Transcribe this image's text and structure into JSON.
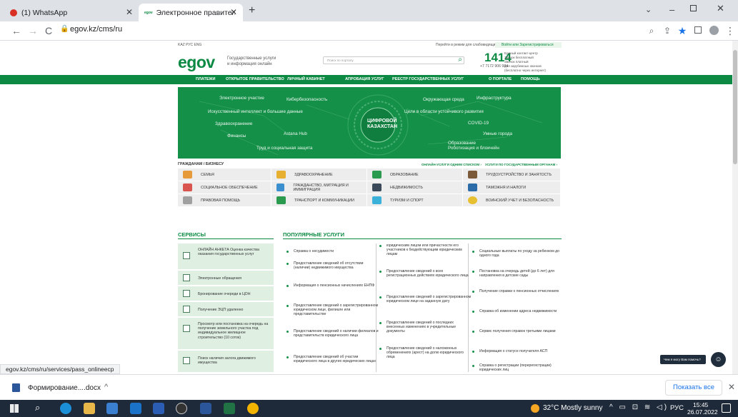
{
  "browser": {
    "tab1": "(1) WhatsApp",
    "tab2": "Электронное правительство Ре",
    "url": "egov.kz/cms/ru",
    "status_url": "egov.kz/cms/ru/services/pass_onlineecp"
  },
  "top": {
    "langs": "KAZ  РУС  ENG",
    "vision": "Перейти в режим для слабовидящих",
    "login": "Войти или Зарегистрироваться",
    "logo": "egov",
    "tagline1": "Государственные услуги",
    "tagline2": "и информация онлайн",
    "search_placeholder": "Поиск по порталу",
    "phone": "1414",
    "phone_sub": "+7 7172 906 984",
    "phone_l1": "Единый контакт-центр",
    "phone_l2": "Звонок бесплатный",
    "phone_l3": "Звонок платный",
    "phone_l4": "для зарубежных звонков",
    "phone_l5": "(бесплатно через интернет)"
  },
  "nav": [
    "ПЛАТЕЖИ",
    "ОТКРЫТОЕ ПРАВИТЕЛЬСТВО",
    "ЛИЧНЫЙ КАБИНЕТ",
    "АПРОБАЦИЯ УСЛУГ",
    "РЕЕСТР ГОСУДАРСТВЕННЫХ УСЛУГ",
    "О ПОРТАЛЕ",
    "ПОМОЩЬ"
  ],
  "banner": {
    "center1": "ЦИФРОВОЙ",
    "center2": "КАЗАХСТАН",
    "items": [
      "Электронное участие",
      "Кибербезопасность",
      "Окружающая среда",
      "Инфраструктура",
      "Искусственный интеллект и большие данные",
      "Цели в области устойчивого развития",
      "Здравоохранение",
      "COVID-19",
      "Финансы",
      "Astana Hub",
      "Умные города",
      "Образование",
      "Труд и социальная защита",
      "Роботизация и блокчейн"
    ]
  },
  "audience": {
    "label": "ГРАЖДАНАМ / БИЗНЕСУ",
    "online": "ОНЛАЙН-УСЛУГИ ОДНИМ СПИСКОМ ›",
    "by_org": "УСЛУГИ ПО ГОСУДАРСТВЕННЫМ ОРГАНАМ ›"
  },
  "categories": [
    "СЕМЬЯ",
    "ЗДРАВООХРАНЕНИЕ",
    "ОБРАЗОВАНИЕ",
    "ТРУДОУСТРОЙСТВО И ЗАНЯТОСТЬ",
    "СОЦИАЛЬНОЕ ОБЕСПЕЧЕНИЕ",
    "ГРАЖДАНСТВО, МИГРАЦИЯ И ИММИГРАЦИЯ",
    "НЕДВИЖИМОСТЬ",
    "ТАМОЖНЯ И НАЛОГИ",
    "ПРАВОВАЯ ПОМОЩЬ",
    "ТРАНСПОРТ И КОММУНИКАЦИИ",
    "ТУРИЗМ И СПОРТ",
    "ВОИНСКИЙ УЧЕТ И БЕЗОПАСНОСТЬ"
  ],
  "services_title": "СЕРВИСЫ",
  "services": [
    "ОНЛАЙН АНКЕТА Оценка качества оказания государственных услуг",
    "Электронные обращения",
    "Бронирование очереди в ЦОН",
    "Получение ЭЦП удаленно",
    "Просмотр или постановка на очередь на получение земельного участка под индивидуальное жилищное строительство (10 соток)",
    "Поиск наличия залога движимого имущества"
  ],
  "popular_title": "ПОПУЛЯРНЫЕ УСЛУГИ",
  "popular": [
    "Справка о несудимости",
    "Предоставление сведений об отсутствии (наличии) недвижимого имущества",
    "Информация о пенсионных начислениях ЕНПФ",
    "Предоставление сведений о зарегистрированном юридическом лице, филиале или представительстве",
    "Предоставление сведений о наличии филиалов и представительств юридического лица",
    "Предоставление сведений об участии юридического лица в других юридических лицах",
    "юридическим лицом или причастности его участников к бездействующим юридическим лицам",
    "Предоставление сведений о всех регистрационных действиях юридического лица",
    "Предоставление сведений о зарегистрированном юридическом лице на заданную дату",
    "Предоставление сведений о последних внесенных изменениях в учредительные документы",
    "Предоставление сведений о наложенных обременениях (арест) на долю юридического лица",
    "Социальные выплаты по уходу за ребенком до одного года",
    "Постановка на очередь детей (до 6 лет) для направления в детские сады",
    "Получение справки о пенсионных отчислениях",
    "Справка об изменении адреса недвижимости",
    "Сервис получения справок третьими лицами",
    "Информация о статусе получателя АСП",
    "Справка о регистрации (перерегистрации) юридических лиц"
  ],
  "chat": "Чем я могу Вам помочь?",
  "download": {
    "file": "Формирование....docx",
    "show_all": "Показать все"
  },
  "taskbar": {
    "weather": "32°C  Mostly sunny",
    "lang": "РУС",
    "time": "15:45",
    "date": "26.07.2022"
  }
}
